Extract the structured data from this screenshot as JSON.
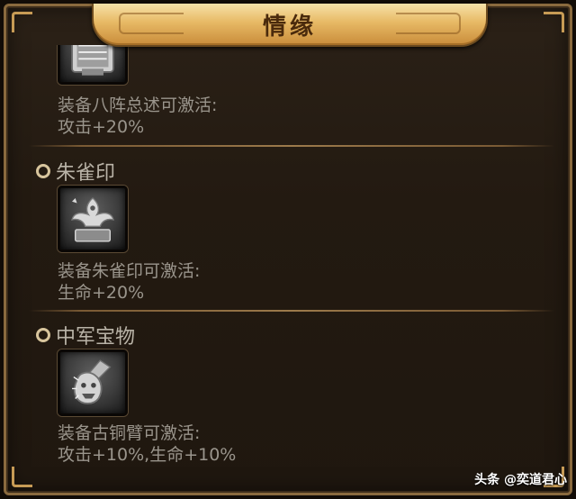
{
  "title": "情缘",
  "entries": [
    {
      "name": "",
      "icon": "bagua-array-icon",
      "condition": "装备八阵总述可激活:",
      "bonus": "攻击+20%"
    },
    {
      "name": "朱雀印",
      "icon": "vermilion-bird-seal-icon",
      "condition": "装备朱雀印可激活:",
      "bonus": "生命+20%"
    },
    {
      "name": "中军宝物",
      "icon": "bronze-arm-guard-icon",
      "condition": "装备古铜臂可激活:",
      "bonus": "攻击+10%,生命+10%"
    }
  ],
  "watermark": "头条 @奕道君心",
  "colors": {
    "panel_bg": "#231a11",
    "banner_gold": "#e7b965",
    "title_text": "#4a2a0c",
    "entry_text": "#9a958c",
    "divider": "#9c7a4b"
  }
}
